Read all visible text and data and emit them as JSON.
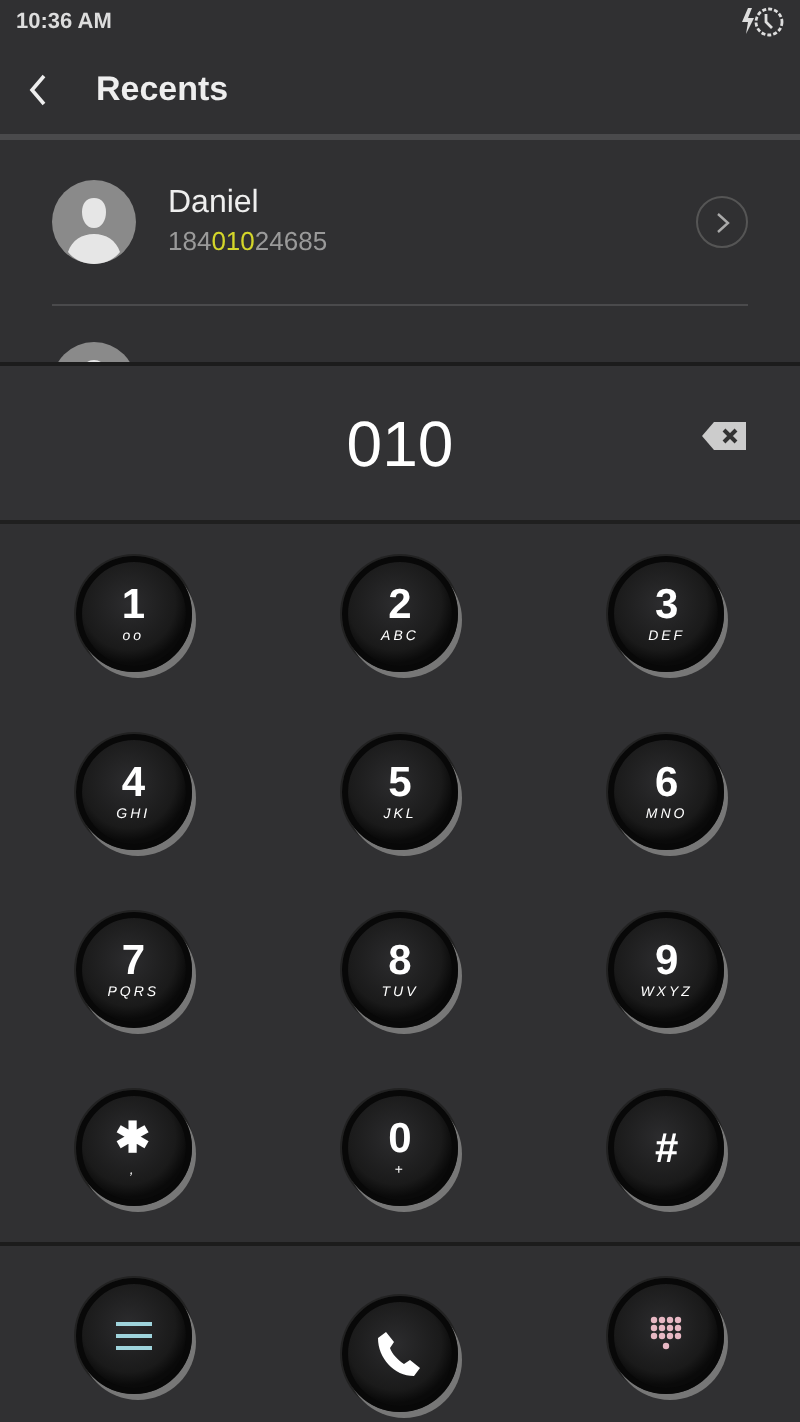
{
  "status_bar": {
    "time": "10:36 AM"
  },
  "header": {
    "title": "Recents"
  },
  "contacts": [
    {
      "name": "Daniel",
      "number_before": "184",
      "number_match": "010",
      "number_after": "24685"
    }
  ],
  "dial": {
    "value": "010"
  },
  "keys": [
    {
      "digit": "1",
      "letters": "oo"
    },
    {
      "digit": "2",
      "letters": "ABC"
    },
    {
      "digit": "3",
      "letters": "DEF"
    },
    {
      "digit": "4",
      "letters": "GHI"
    },
    {
      "digit": "5",
      "letters": "JKL"
    },
    {
      "digit": "6",
      "letters": "MNO"
    },
    {
      "digit": "7",
      "letters": "PQRS"
    },
    {
      "digit": "8",
      "letters": "TUV"
    },
    {
      "digit": "9",
      "letters": "WXYZ"
    },
    {
      "digit": "✱",
      "letters": ","
    },
    {
      "digit": "0",
      "letters": "+"
    },
    {
      "digit": "#"
    }
  ],
  "bottom_buttons": [
    {
      "kind": "menu"
    },
    {
      "kind": "call"
    },
    {
      "kind": "dialpad"
    }
  ]
}
